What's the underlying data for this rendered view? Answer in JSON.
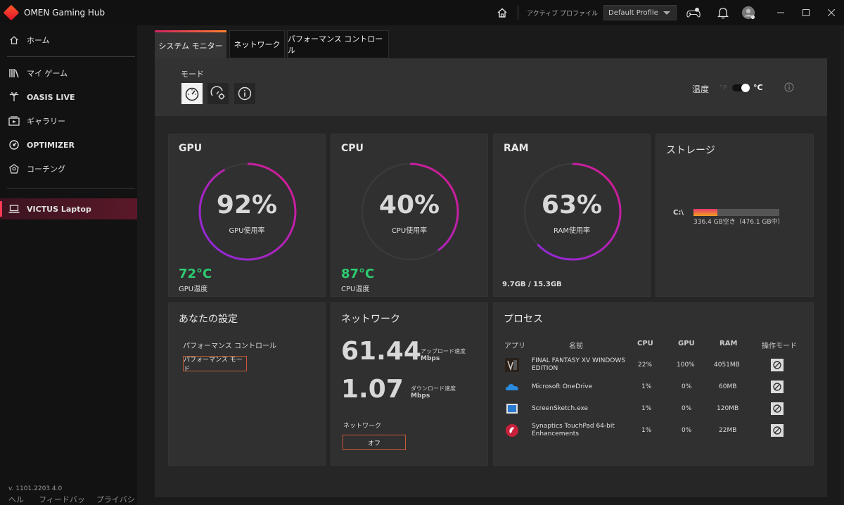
{
  "titlebar": {
    "app_name": "OMEN Gaming Hub",
    "active_profile_label": "アクティブ プロファイル",
    "profile_value": "Default Profile",
    "icons": [
      "home-icon",
      "gamepad-icon",
      "bell-icon",
      "avatar-icon"
    ]
  },
  "sidebar": {
    "items": [
      {
        "label": "ホーム",
        "icon": "home-icon"
      },
      {
        "label": "マイ ゲーム",
        "icon": "library-icon"
      },
      {
        "label": "OASIS LIVE",
        "icon": "oasis-icon"
      },
      {
        "label": "ギャラリー",
        "icon": "gallery-icon"
      },
      {
        "label": "OPTIMIZER",
        "icon": "optimizer-icon"
      },
      {
        "label": "コーチング",
        "icon": "coaching-icon"
      }
    ],
    "device": {
      "label": "VICTUS Laptop",
      "icon": "laptop-icon"
    },
    "version": "v. 1101.2203.4.0",
    "footer_links": [
      "ヘルプ",
      "フィードバック",
      "プライバシー"
    ]
  },
  "tabs": [
    {
      "label": "システム モニター",
      "active": true
    },
    {
      "label": "ネットワーク",
      "active": false
    },
    {
      "label": "パフォーマンス コントロール",
      "active": false
    }
  ],
  "mode": {
    "label": "モード",
    "temperature_label": "温度",
    "unit_f": "°F",
    "unit_c": "°C"
  },
  "gpu": {
    "title": "GPU",
    "usage": "92%",
    "usage_fraction": 0.92,
    "usage_label": "GPU使用率",
    "temp": "72°C",
    "temp_label": "GPU温度"
  },
  "cpu": {
    "title": "CPU",
    "usage": "40%",
    "usage_fraction": 0.4,
    "usage_label": "CPU使用率",
    "temp": "87°C",
    "temp_label": "CPU温度"
  },
  "ram": {
    "title": "RAM",
    "usage": "63%",
    "usage_fraction": 0.63,
    "usage_label": "RAM使用率",
    "amount": "9.7GB / 15.3GB"
  },
  "storage": {
    "title": "ストレージ",
    "drive": "C:\\",
    "used_fraction": 0.28,
    "info": "336.4 GB空き（476.1 GB中）"
  },
  "settings": {
    "title": "あなたの設定",
    "perf_label": "パフォーマンス コントロール",
    "perf_button": "パフォーマンス モード"
  },
  "network": {
    "title": "ネットワーク",
    "upload_value": "61.44",
    "upload_label": "アップロード速度",
    "upload_unit": "Mbps",
    "download_value": "1.07",
    "download_label": "ダウンロード速度",
    "download_unit": "Mbps",
    "net_label": "ネットワーク",
    "net_button": "オフ"
  },
  "process": {
    "title": "プロセス",
    "headers": {
      "app": "アプリ",
      "name": "名前",
      "cpu": "CPU",
      "gpu": "GPU",
      "ram": "RAM",
      "mode": "操作モード"
    },
    "rows": [
      {
        "name": "FINAL FANTASY XV WINDOWS EDITION",
        "cpu": "22%",
        "gpu": "100%",
        "ram": "4051MB",
        "icon": "ffxv-icon"
      },
      {
        "name": "Microsoft OneDrive",
        "cpu": "1%",
        "gpu": "0%",
        "ram": "60MB",
        "icon": "onedrive-icon"
      },
      {
        "name": "ScreenSketch.exe",
        "cpu": "1%",
        "gpu": "0%",
        "ram": "120MB",
        "icon": "screensketch-icon"
      },
      {
        "name": "Synaptics TouchPad 64-bit Enhancements",
        "cpu": "1%",
        "gpu": "0%",
        "ram": "22MB",
        "icon": "synaptics-icon"
      }
    ]
  }
}
